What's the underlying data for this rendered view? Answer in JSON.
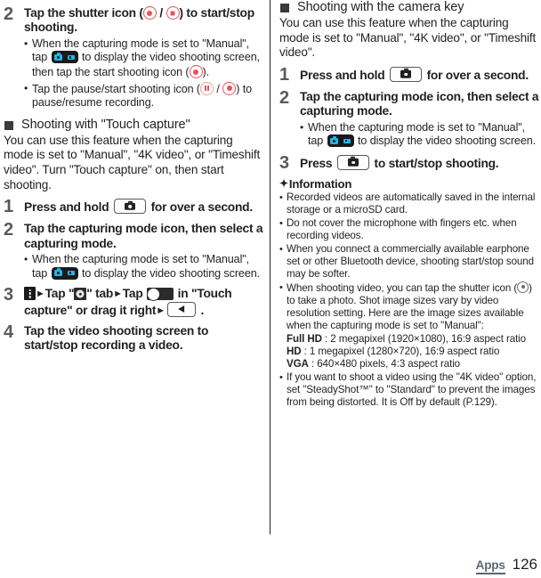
{
  "left_column": {
    "step2": {
      "number": "2",
      "title_a": "Tap the shutter icon (",
      "title_sep": " / ",
      "title_b": ") to start/stop shooting.",
      "bullets": [
        {
          "a": "When the capturing mode is set to \"Manual\", tap ",
          "b": " to display the video shooting screen, then tap the start shooting icon (",
          "c": ")."
        },
        {
          "a": "Tap the pause/start shooting icon (",
          "b": " / ",
          "c": ") to pause/resume recording."
        }
      ]
    },
    "section": {
      "heading": "Shooting with \"Touch capture\"",
      "paragraph": "You can use this feature when the capturing mode is set to \"Manual\", \"4K video\", or \"Timeshift video\". Turn \"Touch capture\" on, then start shooting."
    },
    "steps": [
      {
        "number": "1",
        "title_a": "Press and hold ",
        "title_b": " for over a second."
      },
      {
        "number": "2",
        "title": "Tap the capturing mode icon, then select a capturing mode.",
        "bullet": {
          "a": "When the capturing mode is set to \"Manual\", tap ",
          "b": " to display the video shooting screen."
        }
      },
      {
        "number": "3",
        "t1": "Tap \"",
        "t2": "\" tab",
        "t3": "Tap ",
        "t4": " in \"Touch capture\" or drag it right",
        "t5": " ."
      },
      {
        "number": "4",
        "title": "Tap the video shooting screen to start/stop recording a video."
      }
    ]
  },
  "right_column": {
    "section": {
      "heading": "Shooting with the camera key",
      "paragraph": "You can use this feature when the capturing mode is set to \"Manual\", \"4K video\", or \"Timeshift video\"."
    },
    "steps": [
      {
        "number": "1",
        "title_a": "Press and hold ",
        "title_b": " for over a second."
      },
      {
        "number": "2",
        "title": "Tap the capturing mode icon, then select a capturing mode.",
        "bullet": {
          "a": "When the capturing mode is set to \"Manual\", tap ",
          "b": " to display the video shooting screen."
        }
      },
      {
        "number": "3",
        "title_a": "Press ",
        "title_b": " to start/stop shooting."
      }
    ],
    "information": {
      "heading": "Information",
      "items": [
        {
          "text": "Recorded videos are automatically saved in the internal storage or a microSD card."
        },
        {
          "text": "Do not cover the microphone with fingers etc. when recording videos."
        },
        {
          "text": "When you connect a commercially available earphone set or other Bluetooth device, shooting start/stop sound may be softer."
        },
        {
          "text_a": "When shooting video, you can tap the shutter icon (",
          "text_b": ") to take a photo. Shot image sizes vary by video resolution setting. Here are the image sizes available when the capturing mode is set to \"Manual\":",
          "sizes": [
            {
              "label": "Full HD",
              "value": " : 2 megapixel (1920×1080), 16:9 aspect ratio"
            },
            {
              "label": "HD",
              "value": " : 1 megapixel (1280×720), 16:9 aspect ratio"
            },
            {
              "label": "VGA",
              "value": " : 640×480 pixels, 4:3 aspect ratio"
            }
          ]
        },
        {
          "text": "If you want to shoot a video using the \"4K video\" option, set \"SteadyShot™\" to \"Standard\" to prevent the images from being distorted. It is Off by default (P.129)."
        }
      ]
    }
  },
  "footer": {
    "tag": "Apps",
    "page": "126"
  },
  "colors": {
    "text": "#231f20",
    "step_number": "#58595b",
    "accent_red": "#e8535a",
    "accent_blue": "#1fb6e8",
    "footer_tag": "#5b6770"
  }
}
